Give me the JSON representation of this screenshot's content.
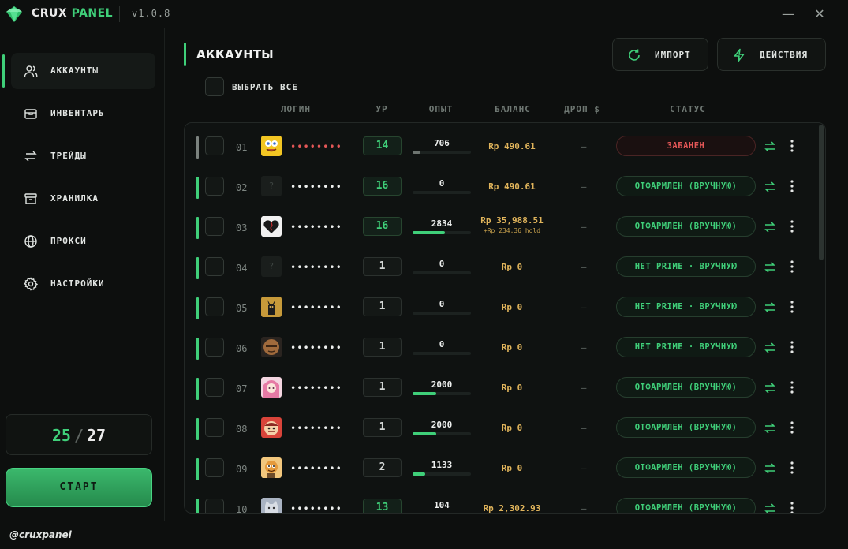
{
  "app": {
    "name_primary": "CRUX",
    "name_accent": "PANEL",
    "version": "v1.0.8",
    "minimize_glyph": "—",
    "close_glyph": "✕"
  },
  "colors": {
    "accent": "#3fcf79",
    "gold": "#e0b45b",
    "banned": "#e35757",
    "background": "#0d0f0e"
  },
  "sidebar": {
    "items": [
      {
        "label": "АККАУНТЫ",
        "icon": "users-icon",
        "active": true
      },
      {
        "label": "ИНВЕНТАРЬ",
        "icon": "inventory-icon",
        "active": false
      },
      {
        "label": "ТРЕЙДЫ",
        "icon": "trades-icon",
        "active": false
      },
      {
        "label": "ХРАНИЛКА",
        "icon": "archive-icon",
        "active": false
      },
      {
        "label": "ПРОКСИ",
        "icon": "globe-icon",
        "active": false
      },
      {
        "label": "НАСТРОЙКИ",
        "icon": "settings-icon",
        "active": false
      }
    ],
    "counter": {
      "current": "25",
      "separator": "/",
      "total": "27"
    },
    "start_label": "СТАРТ"
  },
  "footer": {
    "handle": "@cruxpanel"
  },
  "main": {
    "title": "АККАУНТЫ",
    "import_label": "ИМПОРТ",
    "actions_label": "ДЕЙСТВИЯ",
    "select_all_label": "ВЫБРАТЬ ВСЕ",
    "columns": {
      "login": "ЛОГИН",
      "level": "УР",
      "xp": "ОПЫТ",
      "balance": "БАЛАНС",
      "drop": "ДРОП $",
      "status": "СТАТУС"
    }
  },
  "accounts": [
    {
      "num": "01",
      "login": "••••••••",
      "level": "14",
      "xp": "706",
      "xp_fraction": 0.12,
      "balance": "Rp 490.61",
      "hold": "",
      "drop": "–",
      "status": "ЗАБАНЕН",
      "banned": true,
      "avatar": "yellow-sponge"
    },
    {
      "num": "02",
      "login": "••••••••",
      "level": "16",
      "xp": "0",
      "xp_fraction": 0,
      "balance": "Rp 490.61",
      "hold": "",
      "drop": "–",
      "status": "ОТФАРМЛЕН (ВРУЧНУЮ)",
      "banned": false,
      "avatar": "empty"
    },
    {
      "num": "03",
      "login": "••••••••",
      "level": "16",
      "xp": "2834",
      "xp_fraction": 0.55,
      "balance": "Rp 35,988.51",
      "hold": "+Rp 234.36 hold",
      "drop": "–",
      "status": "ОТФАРМЛЕН (ВРУЧНУЮ)",
      "banned": false,
      "avatar": "heart"
    },
    {
      "num": "04",
      "login": "••••••••",
      "level": "1",
      "xp": "0",
      "xp_fraction": 0,
      "balance": "Rp 0",
      "hold": "",
      "drop": "–",
      "status": "НЕТ PRIME · ВРУЧНУЮ",
      "banned": false,
      "avatar": "empty"
    },
    {
      "num": "05",
      "login": "••••••••",
      "level": "1",
      "xp": "0",
      "xp_fraction": 0,
      "balance": "Rp 0",
      "hold": "",
      "drop": "–",
      "status": "НЕТ PRIME · ВРУЧНУЮ",
      "banned": false,
      "avatar": "anubis"
    },
    {
      "num": "06",
      "login": "••••••••",
      "level": "1",
      "xp": "0",
      "xp_fraction": 0,
      "balance": "Rp 0",
      "hold": "",
      "drop": "–",
      "status": "НЕТ PRIME · ВРУЧНУЮ",
      "banned": false,
      "avatar": "face"
    },
    {
      "num": "07",
      "login": "••••••••",
      "level": "1",
      "xp": "2000",
      "xp_fraction": 0.4,
      "balance": "Rp 0",
      "hold": "",
      "drop": "–",
      "status": "ОТФАРМЛЕН (ВРУЧНУЮ)",
      "banned": false,
      "avatar": "anime"
    },
    {
      "num": "08",
      "login": "••••••••",
      "level": "1",
      "xp": "2000",
      "xp_fraction": 0.4,
      "balance": "Rp 0",
      "hold": "",
      "drop": "–",
      "status": "ОТФАРМЛЕН (ВРУЧНУЮ)",
      "banned": false,
      "avatar": "red-mascot"
    },
    {
      "num": "09",
      "login": "••••••••",
      "level": "2",
      "xp": "1133",
      "xp_fraction": 0.22,
      "balance": "Rp 0",
      "hold": "",
      "drop": "–",
      "status": "ОТФАРМЛЕН (ВРУЧНУЮ)",
      "banned": false,
      "avatar": "cartoon"
    },
    {
      "num": "10",
      "login": "••••••••",
      "level": "13",
      "xp": "104",
      "xp_fraction": 0.03,
      "balance": "Rp 2,302.93",
      "hold": "",
      "drop": "–",
      "status": "ОТФАРМЛЕН (ВРУЧНУЮ)",
      "banned": false,
      "avatar": "gray-cat"
    }
  ]
}
